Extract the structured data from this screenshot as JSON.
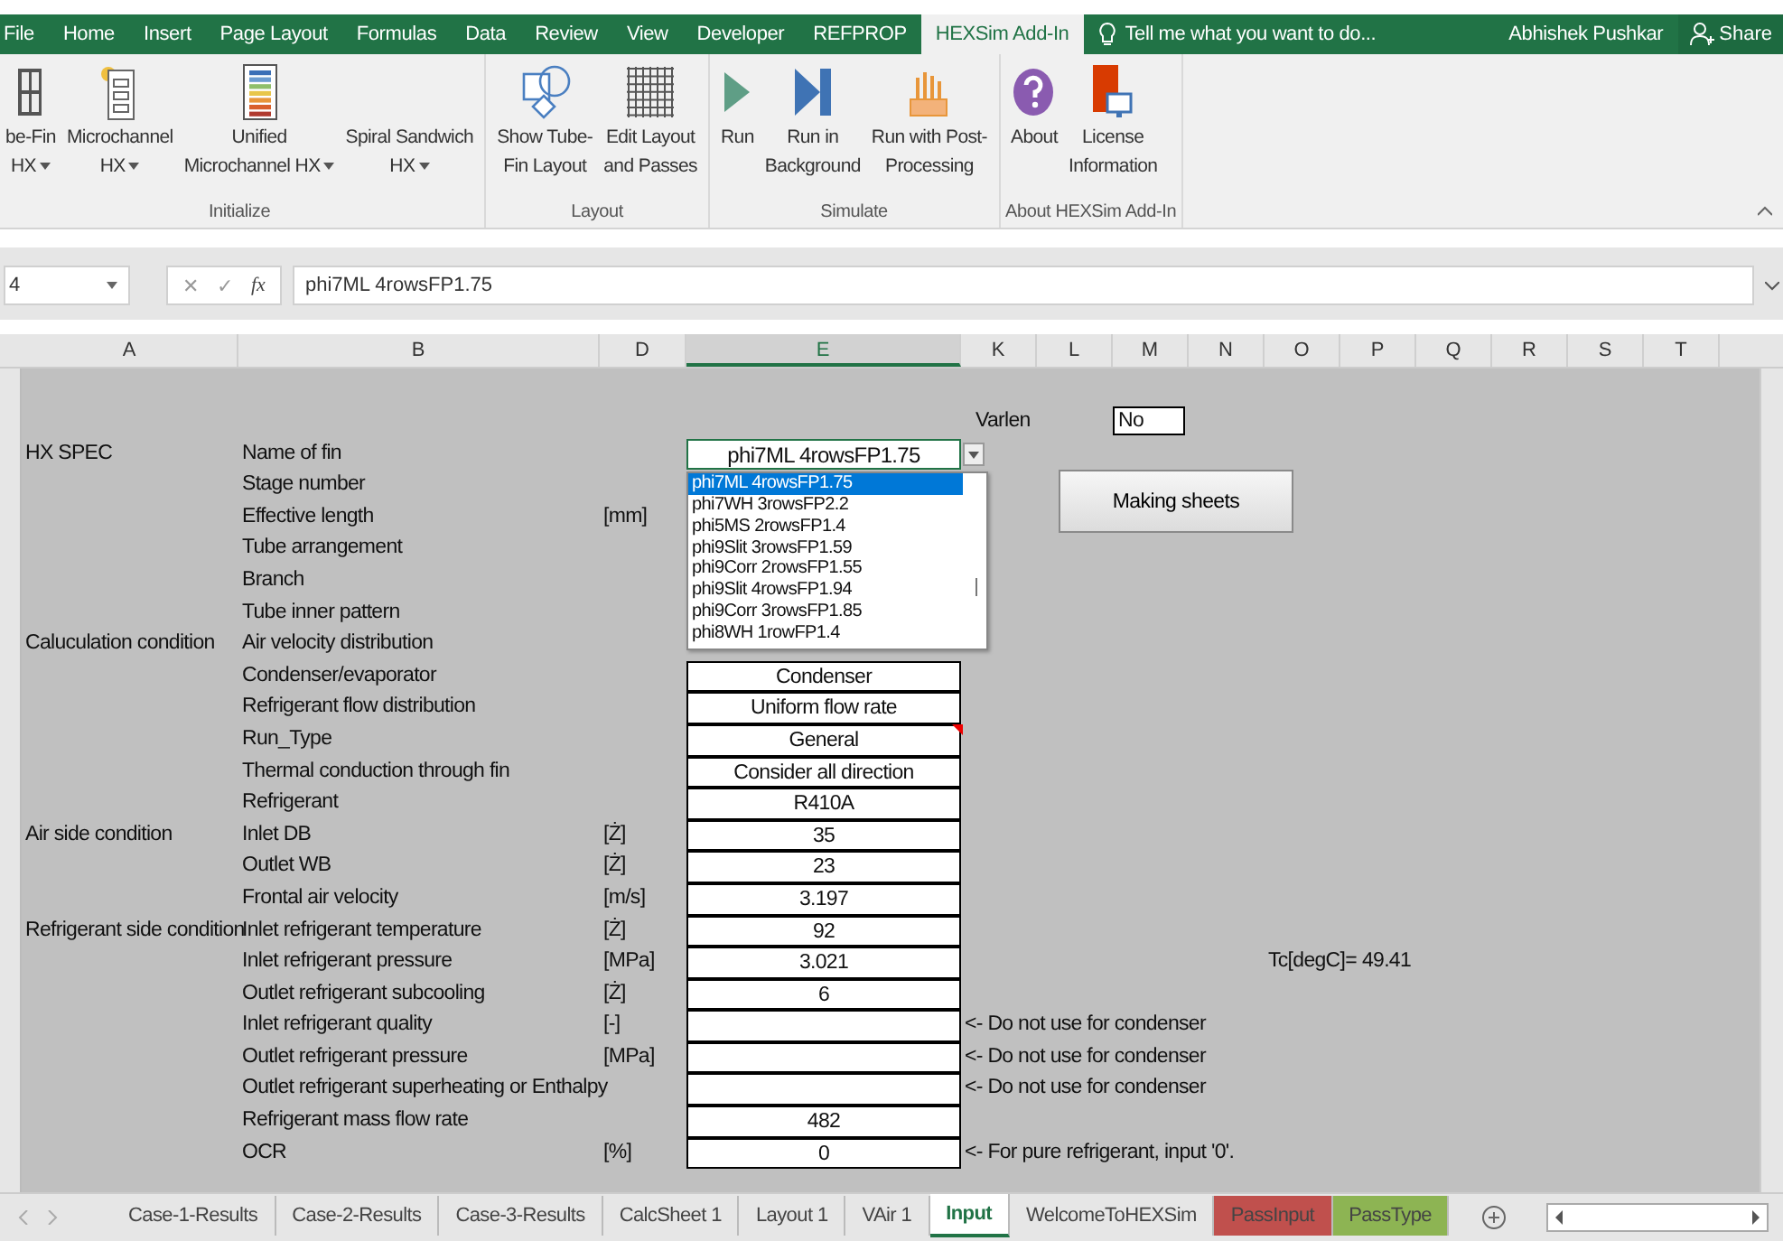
{
  "menu": {
    "tabs": [
      {
        "label": "File",
        "selected": false
      },
      {
        "label": "Home",
        "selected": false
      },
      {
        "label": "Insert",
        "selected": false
      },
      {
        "label": "Page Layout",
        "selected": false
      },
      {
        "label": "Formulas",
        "selected": false
      },
      {
        "label": "Data",
        "selected": false
      },
      {
        "label": "Review",
        "selected": false
      },
      {
        "label": "View",
        "selected": false
      },
      {
        "label": "Developer",
        "selected": false
      },
      {
        "label": "REFPROP",
        "selected": false
      },
      {
        "label": "HEXSim Add-In",
        "selected": true
      }
    ],
    "tell_me": "Tell me what you want to do...",
    "user": "Abhishek Pushkar",
    "share": "Share"
  },
  "ribbon": {
    "groups": [
      {
        "label": "Initialize",
        "buttons": [
          {
            "lines": [
              "be-Fin",
              "HX"
            ],
            "dropdown": true
          },
          {
            "lines": [
              "Microchannel",
              "HX"
            ],
            "dropdown": true
          },
          {
            "lines": [
              "Unified",
              "Microchannel HX"
            ],
            "dropdown": true
          },
          {
            "lines": [
              "Spiral Sandwich",
              "HX"
            ],
            "dropdown": true
          }
        ]
      },
      {
        "label": "Layout",
        "buttons": [
          {
            "lines": [
              "Show Tube-",
              "Fin Layout"
            ],
            "dropdown": false
          },
          {
            "lines": [
              "Edit Layout",
              "and Passes"
            ],
            "dropdown": false
          }
        ]
      },
      {
        "label": "Simulate",
        "buttons": [
          {
            "lines": [
              "Run"
            ],
            "dropdown": false
          },
          {
            "lines": [
              "Run in",
              "Background"
            ],
            "dropdown": false
          },
          {
            "lines": [
              "Run with Post-",
              "Processing"
            ],
            "dropdown": false
          }
        ]
      },
      {
        "label": "About HEXSim Add-In",
        "buttons": [
          {
            "lines": [
              "About"
            ],
            "dropdown": false
          },
          {
            "lines": [
              "License",
              "Information"
            ],
            "dropdown": false
          }
        ]
      }
    ]
  },
  "formula_bar": {
    "name_box": "4",
    "buttons": [
      "✕",
      "✓",
      "fx"
    ],
    "value": "phi7ML 4rowsFP1.75"
  },
  "columns": [
    {
      "label": "A",
      "selected": false
    },
    {
      "label": "B",
      "selected": false
    },
    {
      "label": "D",
      "selected": false
    },
    {
      "label": "E",
      "selected": true
    },
    {
      "label": "K",
      "selected": false
    },
    {
      "label": "L",
      "selected": false
    },
    {
      "label": "M",
      "selected": false
    },
    {
      "label": "N",
      "selected": false
    },
    {
      "label": "O",
      "selected": false
    },
    {
      "label": "P",
      "selected": false
    },
    {
      "label": "Q",
      "selected": false
    },
    {
      "label": "R",
      "selected": false
    },
    {
      "label": "S",
      "selected": false
    },
    {
      "label": "T",
      "selected": false
    }
  ],
  "varlen": {
    "label": "Varlen",
    "value": "No"
  },
  "making_sheets": "Making sheets",
  "rows": [
    {
      "group": "HX SPEC",
      "label": "Name of fin",
      "kind": "dropdown",
      "value": "phi7ML 4rowsFP1.75"
    },
    {
      "label": "Stage number",
      "kind": "covered"
    },
    {
      "label": "Effective length",
      "unit": "[mm]",
      "kind": "covered"
    },
    {
      "label": "Tube arrangement",
      "kind": "covered"
    },
    {
      "label": "Branch",
      "kind": "covered"
    },
    {
      "label": "Tube inner pattern",
      "kind": "covered"
    },
    {
      "group": "Caluculation condition",
      "label": "Air velocity distribution",
      "kind": "covered"
    },
    {
      "label": "Condenser/evaporator",
      "kind": "input",
      "value": "Condenser"
    },
    {
      "label": "Refrigerant flow distribution",
      "kind": "input",
      "value": "Uniform flow rate"
    },
    {
      "label": "Run_Type",
      "kind": "input",
      "value": "General",
      "comment": true
    },
    {
      "label": "Thermal conduction through fin",
      "kind": "input",
      "value": "Consider all direction"
    },
    {
      "label": "Refrigerant",
      "kind": "input",
      "value": "R410A"
    },
    {
      "group": "Air side condition",
      "label": "Inlet DB",
      "unit": "[Ż]",
      "kind": "input",
      "value": "35"
    },
    {
      "label": "Outlet WB",
      "unit": "[Ż]",
      "kind": "input",
      "value": "23"
    },
    {
      "label": "Frontal air velocity",
      "unit": "[m/s]",
      "kind": "input",
      "value": "3.197"
    },
    {
      "group": "Refrigerant side condition",
      "label": "Inlet refrigerant temperature",
      "unit": "[Ż]",
      "kind": "input",
      "value": "92"
    },
    {
      "label": "Inlet refrigerant pressure",
      "unit": "[MPa]",
      "kind": "input",
      "value": "3.021",
      "extra": {
        "label": "Tc[degC]=",
        "value": "49.41"
      }
    },
    {
      "label": "Outlet refrigerant subcooling",
      "unit": "[Ż]",
      "kind": "input",
      "value": "6"
    },
    {
      "label": "Inlet refrigerant quality",
      "unit": "[-]",
      "kind": "input",
      "note": "<- Do not use for condenser"
    },
    {
      "label": "Outlet refrigerant pressure",
      "unit": "[MPa]",
      "kind": "input",
      "note": "<- Do not use for condenser"
    },
    {
      "label": "Outlet refrigerant superheating or Enthalpy",
      "kind": "input",
      "note": "<- Do not use for condenser"
    },
    {
      "label": "Refrigerant mass flow rate",
      "kind": "input",
      "value": "482"
    },
    {
      "label": "OCR",
      "unit": "[%]",
      "kind": "input",
      "value": "0",
      "note": "<- For pure refrigerant, input '0'."
    }
  ],
  "dropdown_list": [
    {
      "label": "phi7ML 4rowsFP1.75",
      "selected": true
    },
    {
      "label": "phi7WH 3rowsFP2.2",
      "selected": false
    },
    {
      "label": "phi5MS 2rowsFP1.4",
      "selected": false
    },
    {
      "label": "phi9Slit 3rowsFP1.59",
      "selected": false
    },
    {
      "label": "phi9Corr 2rowsFP1.55",
      "selected": false
    },
    {
      "label": "phi9Slit 4rowsFP1.94",
      "selected": false
    },
    {
      "label": "phi9Corr 3rowsFP1.85",
      "selected": false
    },
    {
      "label": "phi8WH 1rowFP1.4",
      "selected": false
    }
  ],
  "sheet_tabs": [
    {
      "label": "Case-1-Results",
      "selected": false
    },
    {
      "label": "Case-2-Results",
      "selected": false
    },
    {
      "label": "Case-3-Results",
      "selected": false
    },
    {
      "label": "CalcSheet 1",
      "selected": false
    },
    {
      "label": "Layout 1",
      "selected": false
    },
    {
      "label": "VAir 1",
      "selected": false
    },
    {
      "label": "Input",
      "selected": true
    },
    {
      "label": "WelcomeToHEXSim",
      "selected": false
    },
    {
      "label": "PassInput",
      "selected": false,
      "color": "#c0504d"
    },
    {
      "label": "PassType",
      "selected": false,
      "color": "#8db453"
    }
  ]
}
